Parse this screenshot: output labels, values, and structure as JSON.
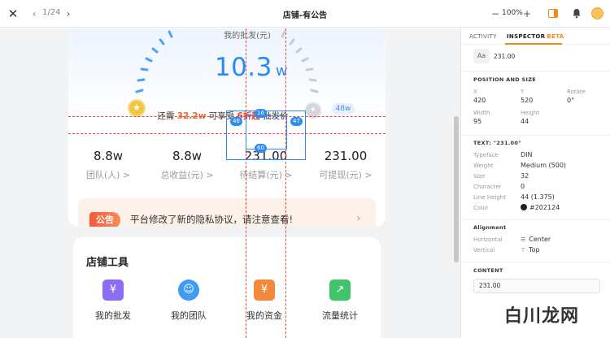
{
  "topbar": {
    "page_indicator": "1/24",
    "title": "店铺-有公告",
    "zoom": "100%"
  },
  "phone": {
    "gauge_label": "我的批发(元)",
    "gauge_value": "10.3",
    "gauge_unit": "w",
    "hint": {
      "prefix": "还需",
      "amount": "32.2w",
      "middle": "可享受",
      "discount": "6折起",
      "suffix": "批发价"
    },
    "next_level": "48w",
    "stats": [
      {
        "value": "8.8w",
        "label": "团队(人) >"
      },
      {
        "value": "8.8w",
        "label": "总收益(元) >"
      },
      {
        "value": "231.00",
        "label": "待结算(元) >"
      },
      {
        "value": "231.00",
        "label": "可提现(元) >"
      }
    ],
    "notice": {
      "tag": "公告",
      "text": "平台修改了新的隐私协议，请注意查看!"
    },
    "tools": {
      "title": "店铺工具",
      "items": [
        {
          "label": "我的批发",
          "icon": "wholesale-icon",
          "color": "#8c6cf0"
        },
        {
          "label": "我的团队",
          "icon": "team-icon",
          "color": "#3f9bf5"
        },
        {
          "label": "我的资金",
          "icon": "funds-icon",
          "color": "#f5893b"
        },
        {
          "label": "流量统计",
          "icon": "traffic-stats-icon",
          "color": "#3fc46a"
        }
      ]
    }
  },
  "measure": {
    "top": "16",
    "left": "46",
    "right": "47",
    "bottom": "60"
  },
  "inspector": {
    "tab_activity": "ACTIVITY",
    "tab_inspector": "INSPECTOR",
    "tab_beta": "BETA",
    "aa": "Aa",
    "layer_value": "231.00",
    "pos_title": "POSITION AND SIZE",
    "x_label": "X",
    "x_value": "420",
    "y_label": "Y",
    "y_value": "520",
    "rotate_label": "Rotate",
    "rotate_value": "0°",
    "width_label": "Width",
    "width_value": "95",
    "height_label": "Height",
    "height_value": "44",
    "text_title": "TEXT: \"231.00\"",
    "typeface_label": "Typeface",
    "typeface_value": "DIN",
    "weight_label": "Weight",
    "weight_value": "Medium (500)",
    "size_label": "Size",
    "size_value": "32",
    "char_label": "Character",
    "char_value": "0",
    "lineheight_label": "Line Height",
    "lineheight_value": "44 (1.375)",
    "color_label": "Color",
    "color_value": "#202124",
    "align_title": "Alignment",
    "horizontal_label": "Horizontal",
    "horizontal_value": "Center",
    "vertical_label": "Vertical",
    "vertical_value": "Top",
    "content_title": "CONTENT",
    "content_value": "231.00"
  },
  "watermark": "白川龙网",
  "colors": {
    "accent_blue": "#2a8af6",
    "accent_orange": "#f08b1e",
    "guide_red": "#e54444",
    "selection_blue": "#2d8cf0"
  }
}
